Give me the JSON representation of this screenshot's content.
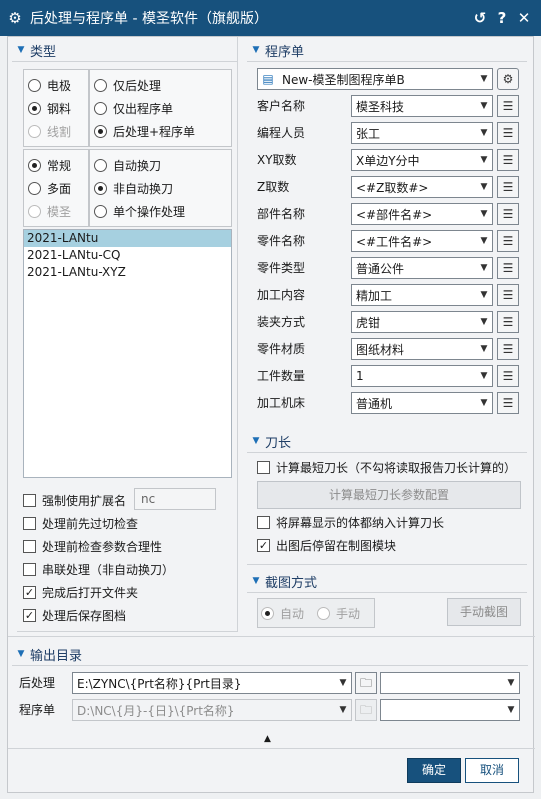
{
  "title": "后处理与程序单 - 模圣软件（旗舰版）",
  "title_controls": [
    "↺",
    "?",
    "✕"
  ],
  "type_section": {
    "header": "类型",
    "group1_left": [
      {
        "label": "电极",
        "state": "off",
        "enabled": true
      },
      {
        "label": "钢料",
        "state": "on",
        "enabled": true
      },
      {
        "label": "线割",
        "state": "off",
        "enabled": false
      }
    ],
    "group1_right": [
      {
        "label": "仅后处理",
        "state": "off"
      },
      {
        "label": "仅出程序单",
        "state": "off"
      },
      {
        "label": "后处理+程序单",
        "state": "on"
      }
    ],
    "group2_left": [
      {
        "label": "常规",
        "state": "on",
        "enabled": true
      },
      {
        "label": "多面",
        "state": "off",
        "enabled": true
      },
      {
        "label": "模圣",
        "state": "off",
        "enabled": false
      }
    ],
    "group2_right": [
      {
        "label": "自动换刀",
        "state": "off"
      },
      {
        "label": "非自动换刀",
        "state": "on"
      },
      {
        "label": "单个操作处理",
        "state": "off"
      }
    ],
    "list": [
      "2021-LANtu",
      "2021-LANtu-CQ",
      "2021-LANtu-XYZ"
    ],
    "selected_index": 0,
    "ext_label": "强制使用扩展名",
    "ext_value": "nc",
    "checks": [
      {
        "label": "处理前先过切检查",
        "checked": false
      },
      {
        "label": "处理前检查参数合理性",
        "checked": false
      },
      {
        "label": "串联处理（非自动换刀）",
        "checked": false
      },
      {
        "label": "完成后打开文件夹",
        "checked": true
      },
      {
        "label": "处理后保存图档",
        "checked": true
      }
    ]
  },
  "program": {
    "header": "程序单",
    "template": "New-模圣制图程序单B",
    "fields": [
      {
        "label": "客户名称",
        "value": "模圣科技"
      },
      {
        "label": "编程人员",
        "value": "张工"
      },
      {
        "label": "XY取数",
        "value": "X单边Y分中"
      },
      {
        "label": "Z取数",
        "value": "<#Z取数#>"
      },
      {
        "label": "部件名称",
        "value": "<#部件名#>"
      },
      {
        "label": "零件名称",
        "value": "<#工件名#>"
      },
      {
        "label": "零件类型",
        "value": "普通公件"
      },
      {
        "label": "加工内容",
        "value": "精加工"
      },
      {
        "label": "装夹方式",
        "value": "虎钳"
      },
      {
        "label": "零件材质",
        "value": "图纸材料"
      },
      {
        "label": "工件数量",
        "value": "1"
      },
      {
        "label": "加工机床",
        "value": "普通机"
      }
    ]
  },
  "tool": {
    "header": "刀长",
    "calc_label": "计算最短刀长（不勾将读取报告刀长计算的）",
    "calc_checked": false,
    "config_button": "计算最短刀长参数配置",
    "include_label": "将屏幕显示的体都纳入计算刀长",
    "include_checked": false,
    "stay_label": "出图后停留在制图模块",
    "stay_checked": true
  },
  "capture": {
    "header": "截图方式",
    "auto": "自动",
    "manual": "手动",
    "manual_button": "手动截图"
  },
  "output": {
    "header": "输出目录",
    "post_label": "后处理",
    "post_value": "E:\\ZYNC\\{Prt名称}{Prt目录}",
    "sheet_label": "程序单",
    "sheet_value": "D:\\NC\\{月}-{日}\\{Prt名称}"
  },
  "footer": {
    "ok": "确定",
    "cancel": "取消",
    "collapse": "▲"
  },
  "colors": {
    "title_bar": "#17517d",
    "accent": "#1e6fb6",
    "selected_row": "#a6d0e0"
  }
}
